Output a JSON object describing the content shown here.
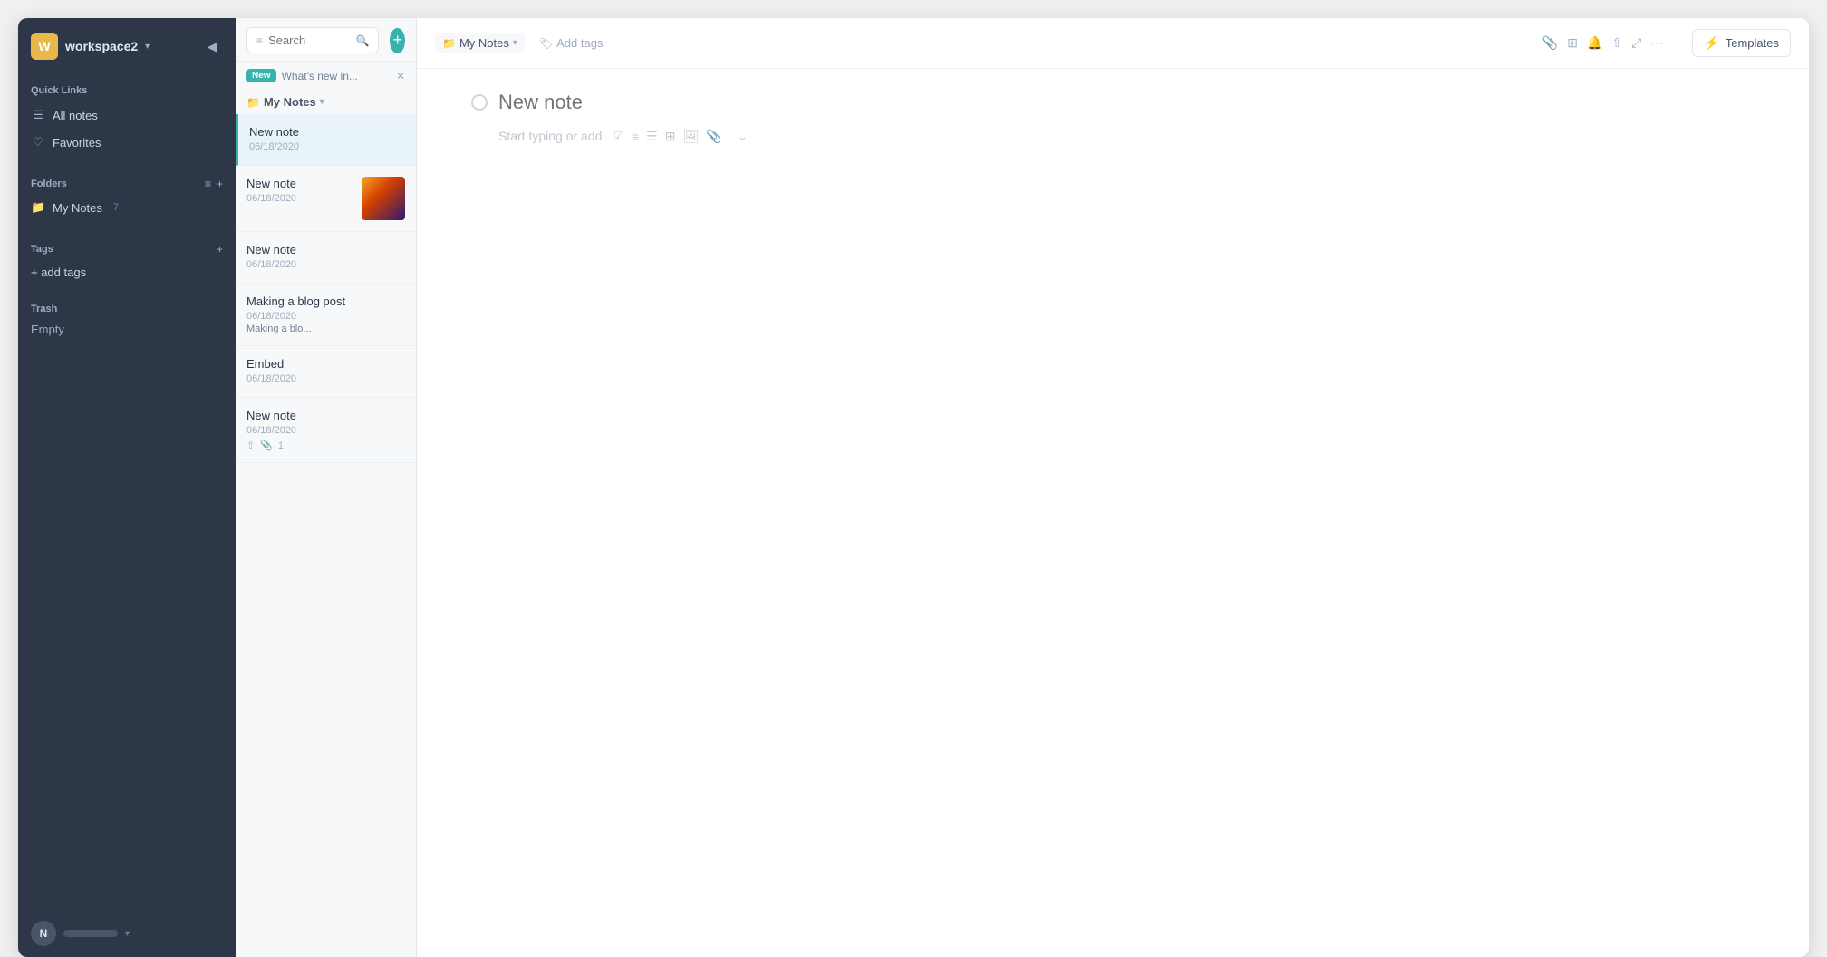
{
  "workspace": {
    "avatar_letter": "W",
    "name": "workspace2",
    "chevron": "▾"
  },
  "sidebar": {
    "collapse_icon": "◀",
    "quick_links_label": "Quick Links",
    "all_notes_label": "All notes",
    "favorites_label": "Favorites",
    "folders_label": "Folders",
    "folders_sort_icon": "≡",
    "folders_add_icon": "+",
    "my_notes_label": "My Notes",
    "my_notes_count": "7",
    "tags_label": "Tags",
    "tags_add_icon": "+",
    "add_tags_label": "+ add tags",
    "trash_label": "Trash",
    "empty_label": "Empty"
  },
  "notes_panel": {
    "search_placeholder": "Search",
    "new_tag": "New",
    "whats_new_text": "What's new in...",
    "folder_icon": "📁",
    "folder_name": "My Notes",
    "folder_chevron": "▾",
    "new_note_button": "+",
    "notes": [
      {
        "id": 1,
        "title": "New note",
        "date": "06/18/2020",
        "preview": "",
        "thumb": false,
        "active": true
      },
      {
        "id": 2,
        "title": "New note",
        "date": "06/18/2020",
        "preview": "",
        "thumb": true
      },
      {
        "id": 3,
        "title": "New note",
        "date": "06/18/2020",
        "preview": "",
        "thumb": false
      },
      {
        "id": 4,
        "title": "Making a blog post",
        "date": "06/18/2020",
        "preview": "Making a blo...",
        "thumb": false
      },
      {
        "id": 5,
        "title": "Embed",
        "date": "06/18/2020",
        "preview": "",
        "thumb": false
      },
      {
        "id": 6,
        "title": "New note",
        "date": "06/18/2020",
        "preview": "",
        "thumb": false,
        "has_meta": true,
        "attachment_count": "1"
      }
    ]
  },
  "editor": {
    "folder_name": "My Notes",
    "add_tags_label": "Add tags",
    "new_note_title_placeholder": "New note",
    "start_typing_placeholder": "Start typing or add",
    "templates_label": "Templates",
    "toolbar_icons": {
      "attach": "📎",
      "grid": "⊞",
      "bell": "🔔",
      "share": "⇧",
      "expand": "⤢",
      "more": "⋯"
    }
  },
  "user": {
    "avatar_letter": "N"
  }
}
